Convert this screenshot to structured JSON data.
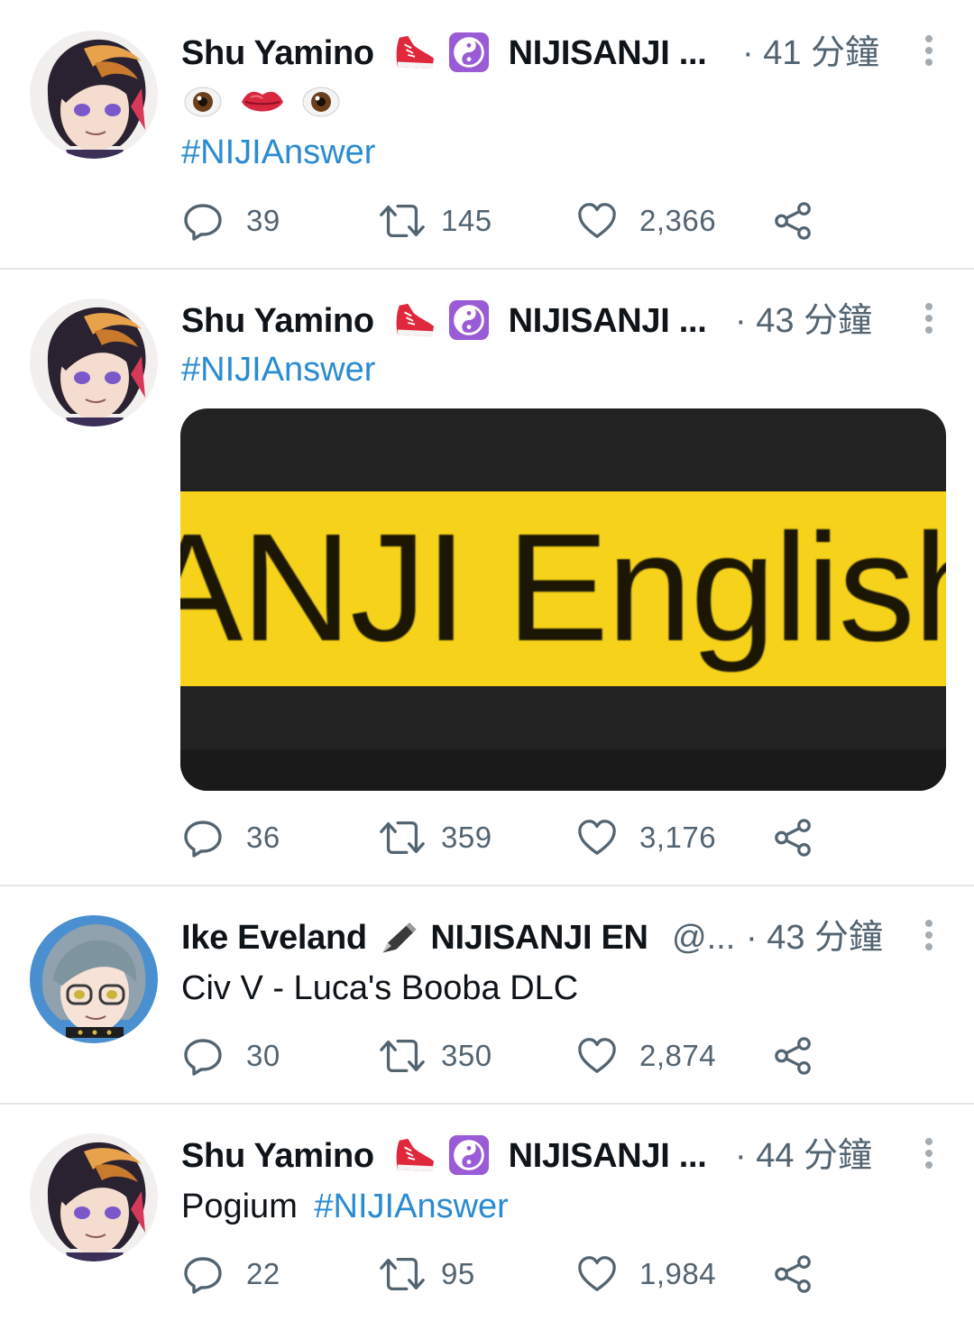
{
  "tweets": [
    {
      "author": "Shu Yamino",
      "badge_text": "NIJISANJI ...",
      "time": "· 41 分鐘",
      "text_hashtag": "#NIJIAnswer",
      "replies": "39",
      "retweets": "145",
      "likes": "2,366"
    },
    {
      "author": "Shu Yamino",
      "badge_text": "NIJISANJI ...",
      "time": "· 43 分鐘",
      "text_hashtag": "#NIJIAnswer",
      "media_text": "ANJI English (",
      "replies": "36",
      "retweets": "359",
      "likes": "3,176"
    },
    {
      "author": "Ike Eveland",
      "badge_text": "NIJISANJI EN",
      "handle": "@...",
      "time": "· 43 分鐘",
      "text": "Civ V - Luca's Booba DLC",
      "replies": "30",
      "retweets": "350",
      "likes": "2,874"
    },
    {
      "author": "Shu Yamino",
      "badge_text": "NIJISANJI ...",
      "time": "· 44 分鐘",
      "text_plain": "Pogium",
      "text_hashtag": "#NIJIAnswer",
      "replies": "22",
      "retweets": "95",
      "likes": "1,984"
    }
  ],
  "colors": {
    "hashtag": "#2a8bd0",
    "meta": "#536471",
    "divider": "#e4e7ea",
    "media_band": "#f6d21a"
  }
}
